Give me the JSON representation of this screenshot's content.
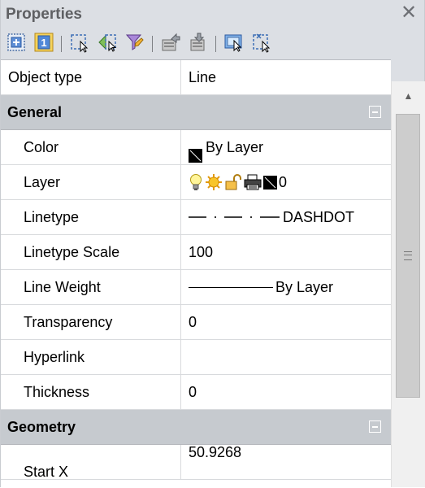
{
  "palette": {
    "title": "Properties",
    "close_glyph": "✕"
  },
  "toolbar": {
    "buttons": [
      {
        "name": "add-to-selection-icon"
      },
      {
        "name": "select-one-icon",
        "label": "1"
      },
      {
        "name": "select-objects-icon"
      },
      {
        "name": "quick-select-icon"
      },
      {
        "name": "select-similar-icon"
      },
      {
        "name": "export-properties-icon"
      },
      {
        "name": "import-properties-icon"
      },
      {
        "name": "toggle-pickadd-icon"
      },
      {
        "name": "deselect-icon"
      }
    ]
  },
  "grid": {
    "top_row": {
      "name": "Object type",
      "value": "Line"
    },
    "general": {
      "label": "General",
      "rows": [
        {
          "name": "Color",
          "value": "By Layer",
          "color": "#000000"
        },
        {
          "name": "Layer",
          "value": "0",
          "icons": [
            "lightbulb-icon",
            "sun-icon",
            "lock-open-icon",
            "printer-icon",
            "color-swatch-icon"
          ]
        },
        {
          "name": "Linetype",
          "value": "DASHDOT"
        },
        {
          "name": "Linetype Scale",
          "value": "100"
        },
        {
          "name": "Line Weight",
          "value": "By Layer"
        },
        {
          "name": "Transparency",
          "value": "0"
        },
        {
          "name": "Hyperlink",
          "value": ""
        },
        {
          "name": "Thickness",
          "value": "0"
        }
      ]
    },
    "geometry": {
      "label": "Geometry",
      "rows": [
        {
          "name": "Start X",
          "value": "50.9268"
        }
      ]
    }
  },
  "colors": {
    "category_bg": "#c6cacf",
    "palette_bg": "#dcdfe4",
    "title_text": "#5f6063"
  }
}
